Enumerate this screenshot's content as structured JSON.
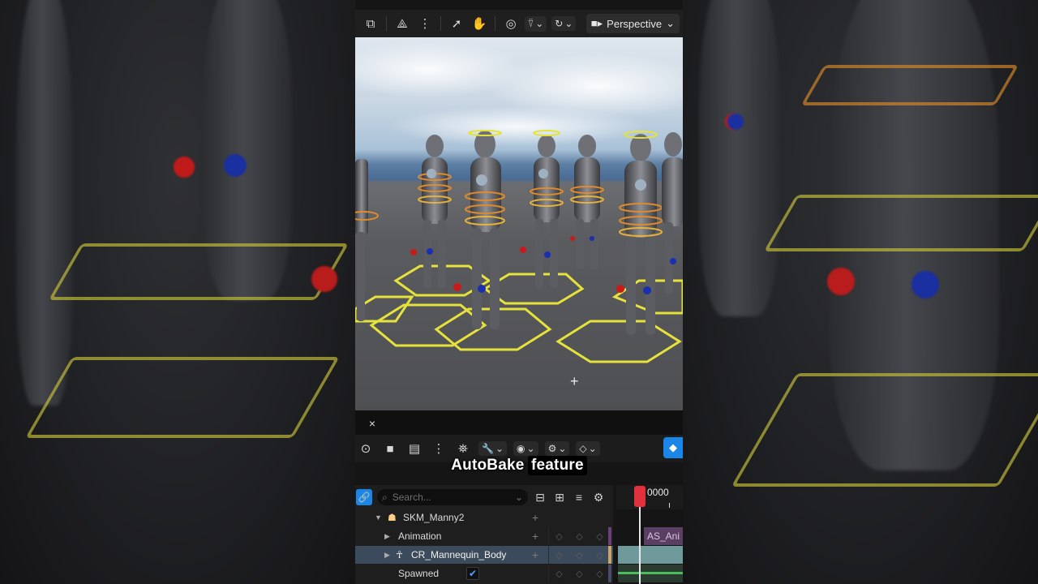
{
  "viewport": {
    "view_mode_label": "Perspective"
  },
  "panel": {
    "close_label": "×"
  },
  "caption": {
    "text_plain": "AutoBake",
    "text_highlight": "feature"
  },
  "outliner": {
    "search_placeholder": "Search...",
    "tracks": [
      {
        "label": "SKM_Manny2",
        "kind": "actor"
      },
      {
        "label": "Animation",
        "kind": "animation"
      },
      {
        "label": "CR_Mannequin_Body",
        "kind": "control-rig",
        "selected": true
      },
      {
        "label": "Spawned",
        "kind": "bool",
        "checked": true
      }
    ]
  },
  "timeline": {
    "current_frame": "0000",
    "animation_clip_label": "AS_Ani"
  },
  "colors": {
    "accent_blue": "#1a86e8",
    "playhead_red": "#e0313d",
    "selection_row": "#3c4b5c",
    "rig_yellow": "#e6e23c",
    "rig_orange": "#e08a2a"
  }
}
